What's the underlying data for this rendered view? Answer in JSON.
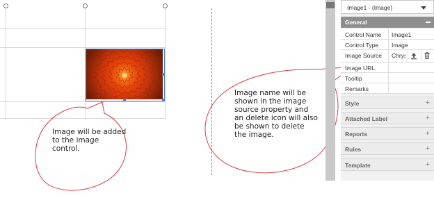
{
  "panel": {
    "selector": "Image1 - (Image)",
    "general_header": "General",
    "properties": [
      {
        "key": "Control Name",
        "value": "Image1"
      },
      {
        "key": "Control Type",
        "value": "Image"
      },
      {
        "key": "Image Source",
        "value": "Chrys"
      },
      {
        "key": "Image URL",
        "value": ""
      },
      {
        "key": "Tooltip",
        "value": ""
      },
      {
        "key": "Remarks",
        "value": ""
      }
    ],
    "sections": [
      "Style",
      "Attached Label",
      "Reports",
      "Rules",
      "Template"
    ],
    "icons": {
      "upload": "upload-icon",
      "delete": "trash-icon",
      "caret": "chevron-down-icon"
    }
  },
  "callouts": {
    "left": "Image will be added to the image control.",
    "right": "Image name will be shown in the image source property and an delete icon will also be shown to delete the image."
  },
  "colors": {
    "callout_stroke": "#e23a3a",
    "general_header": "#8e8e8e",
    "selection": "#4a7fd0",
    "divider": "#5b8fd6"
  }
}
